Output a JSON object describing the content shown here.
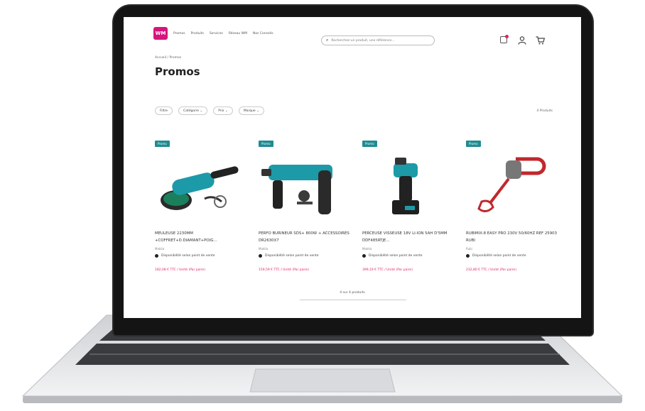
{
  "nav": {
    "logo": "WM",
    "items": [
      "Promos",
      "Produits",
      "Services",
      "Réseau WM",
      "Nos Conseils"
    ]
  },
  "search": {
    "placeholder": "Recherchez un produit, une référence..."
  },
  "breadcrumb": "Accueil  /  Promos",
  "page_title": "Promos",
  "filters": [
    "Filtre",
    "Catégorie",
    "Prix",
    "Marque"
  ],
  "result_count": "4 Produits",
  "products": [
    {
      "badge": "Promo",
      "name": "Meuleuse 2230MM +coffret+d.diamant+poig...",
      "brand": "Makita",
      "availability": "Disponibilité selon point de vente",
      "price": "182,08 € TTC / Unité (Par paire)"
    },
    {
      "badge": "Promo",
      "name": "Perfo Burineur SDS+ 800W + Accessoires DR2630X7",
      "brand": "Makita",
      "availability": "Disponibilité selon point de vente",
      "price": "159,59 € TTC / Unité (Par paire)"
    },
    {
      "badge": "Promo",
      "name": "Perceuse visseuse 18V Li-ion 5Ah d'5mm DDF485RTJE...",
      "brand": "Makita",
      "availability": "Disponibilité selon point de vente",
      "price": "399,19 € TTC / Unité (Par paire)"
    },
    {
      "badge": "Promo",
      "name": "Rubimix-8 Easy Pro 230V 50/60Hz Ref 25903 Rubi",
      "brand": "Rubi",
      "availability": "Disponibilité selon point de vente",
      "price": "232,80 € TTC / Unité (Par paire)"
    }
  ],
  "pager": "4 sur 4 produits",
  "colors": {
    "brand": "#d6157f",
    "badge": "#1f8c92",
    "price": "#e0245e"
  },
  "icons": [
    "search-icon",
    "gift-icon",
    "user-icon",
    "cart-icon",
    "chevron-down-icon"
  ]
}
